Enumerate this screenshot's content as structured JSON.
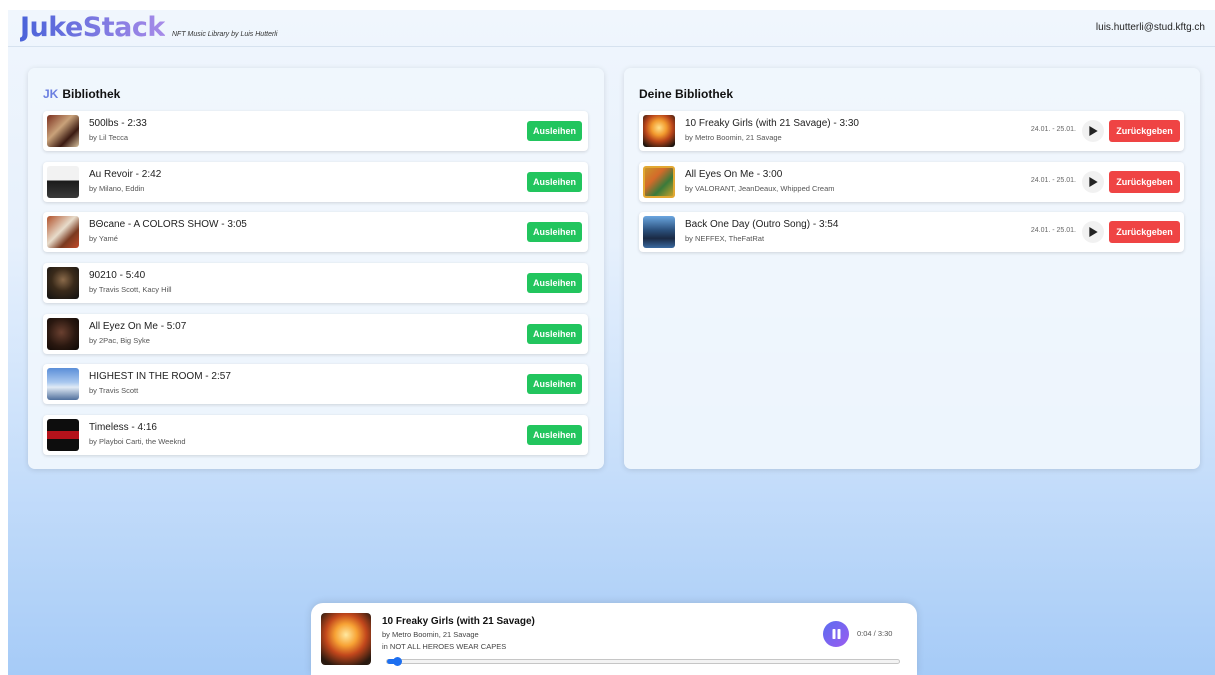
{
  "header": {
    "logo": "JukeStack",
    "tagline": "NFT Music Library by Luis Hutterli",
    "user_email": "luis.hutterli@stud.kftg.ch"
  },
  "library": {
    "title_prefix": "JK",
    "title": "Bibliothek",
    "borrow_label": "Ausleihen",
    "tracks": [
      {
        "title": "500lbs - 2:33",
        "artist": "by Lil Tecca"
      },
      {
        "title": "Au Revoir - 2:42",
        "artist": "by Milano, Eddin"
      },
      {
        "title": "BΘcane - A COLORS SHOW - 3:05",
        "artist": "by Yamé"
      },
      {
        "title": "90210 - 5:40",
        "artist": "by Travis Scott, Kacy Hill"
      },
      {
        "title": "All Eyez On Me - 5:07",
        "artist": "by 2Pac, Big Syke"
      },
      {
        "title": "HIGHEST IN THE ROOM - 2:57",
        "artist": "by Travis Scott"
      },
      {
        "title": "Timeless - 4:16",
        "artist": "by Playboi Carti, the Weeknd"
      }
    ]
  },
  "my_library": {
    "title": "Deine Bibliothek",
    "return_label": "Zurückgeben",
    "tracks": [
      {
        "title": "10 Freaky Girls (with 21 Savage) - 3:30",
        "artist": "by Metro Boomin, 21 Savage",
        "dates": "24.01. - 25.01."
      },
      {
        "title": "All Eyes On Me - 3:00",
        "artist": "by VALORANT, JeanDeaux, Whipped Cream",
        "dates": "24.01. - 25.01."
      },
      {
        "title": "Back One Day (Outro Song) - 3:54",
        "artist": "by NEFFEX, TheFatRat",
        "dates": "24.01. - 25.01."
      }
    ]
  },
  "player": {
    "title": "10 Freaky Girls (with 21 Savage)",
    "artist": "by Metro Boomin, 21 Savage",
    "album": "in NOT ALL HEROES WEAR CAPES",
    "time": "0:04 / 3:30",
    "progress": 0.019
  },
  "colors": {
    "borrow": "#22c55e",
    "return": "#ef4444",
    "accent": "#6b7fe0",
    "progress": "#1d6ff0"
  },
  "icons": {
    "play": "play-icon",
    "pause": "pause-icon"
  }
}
